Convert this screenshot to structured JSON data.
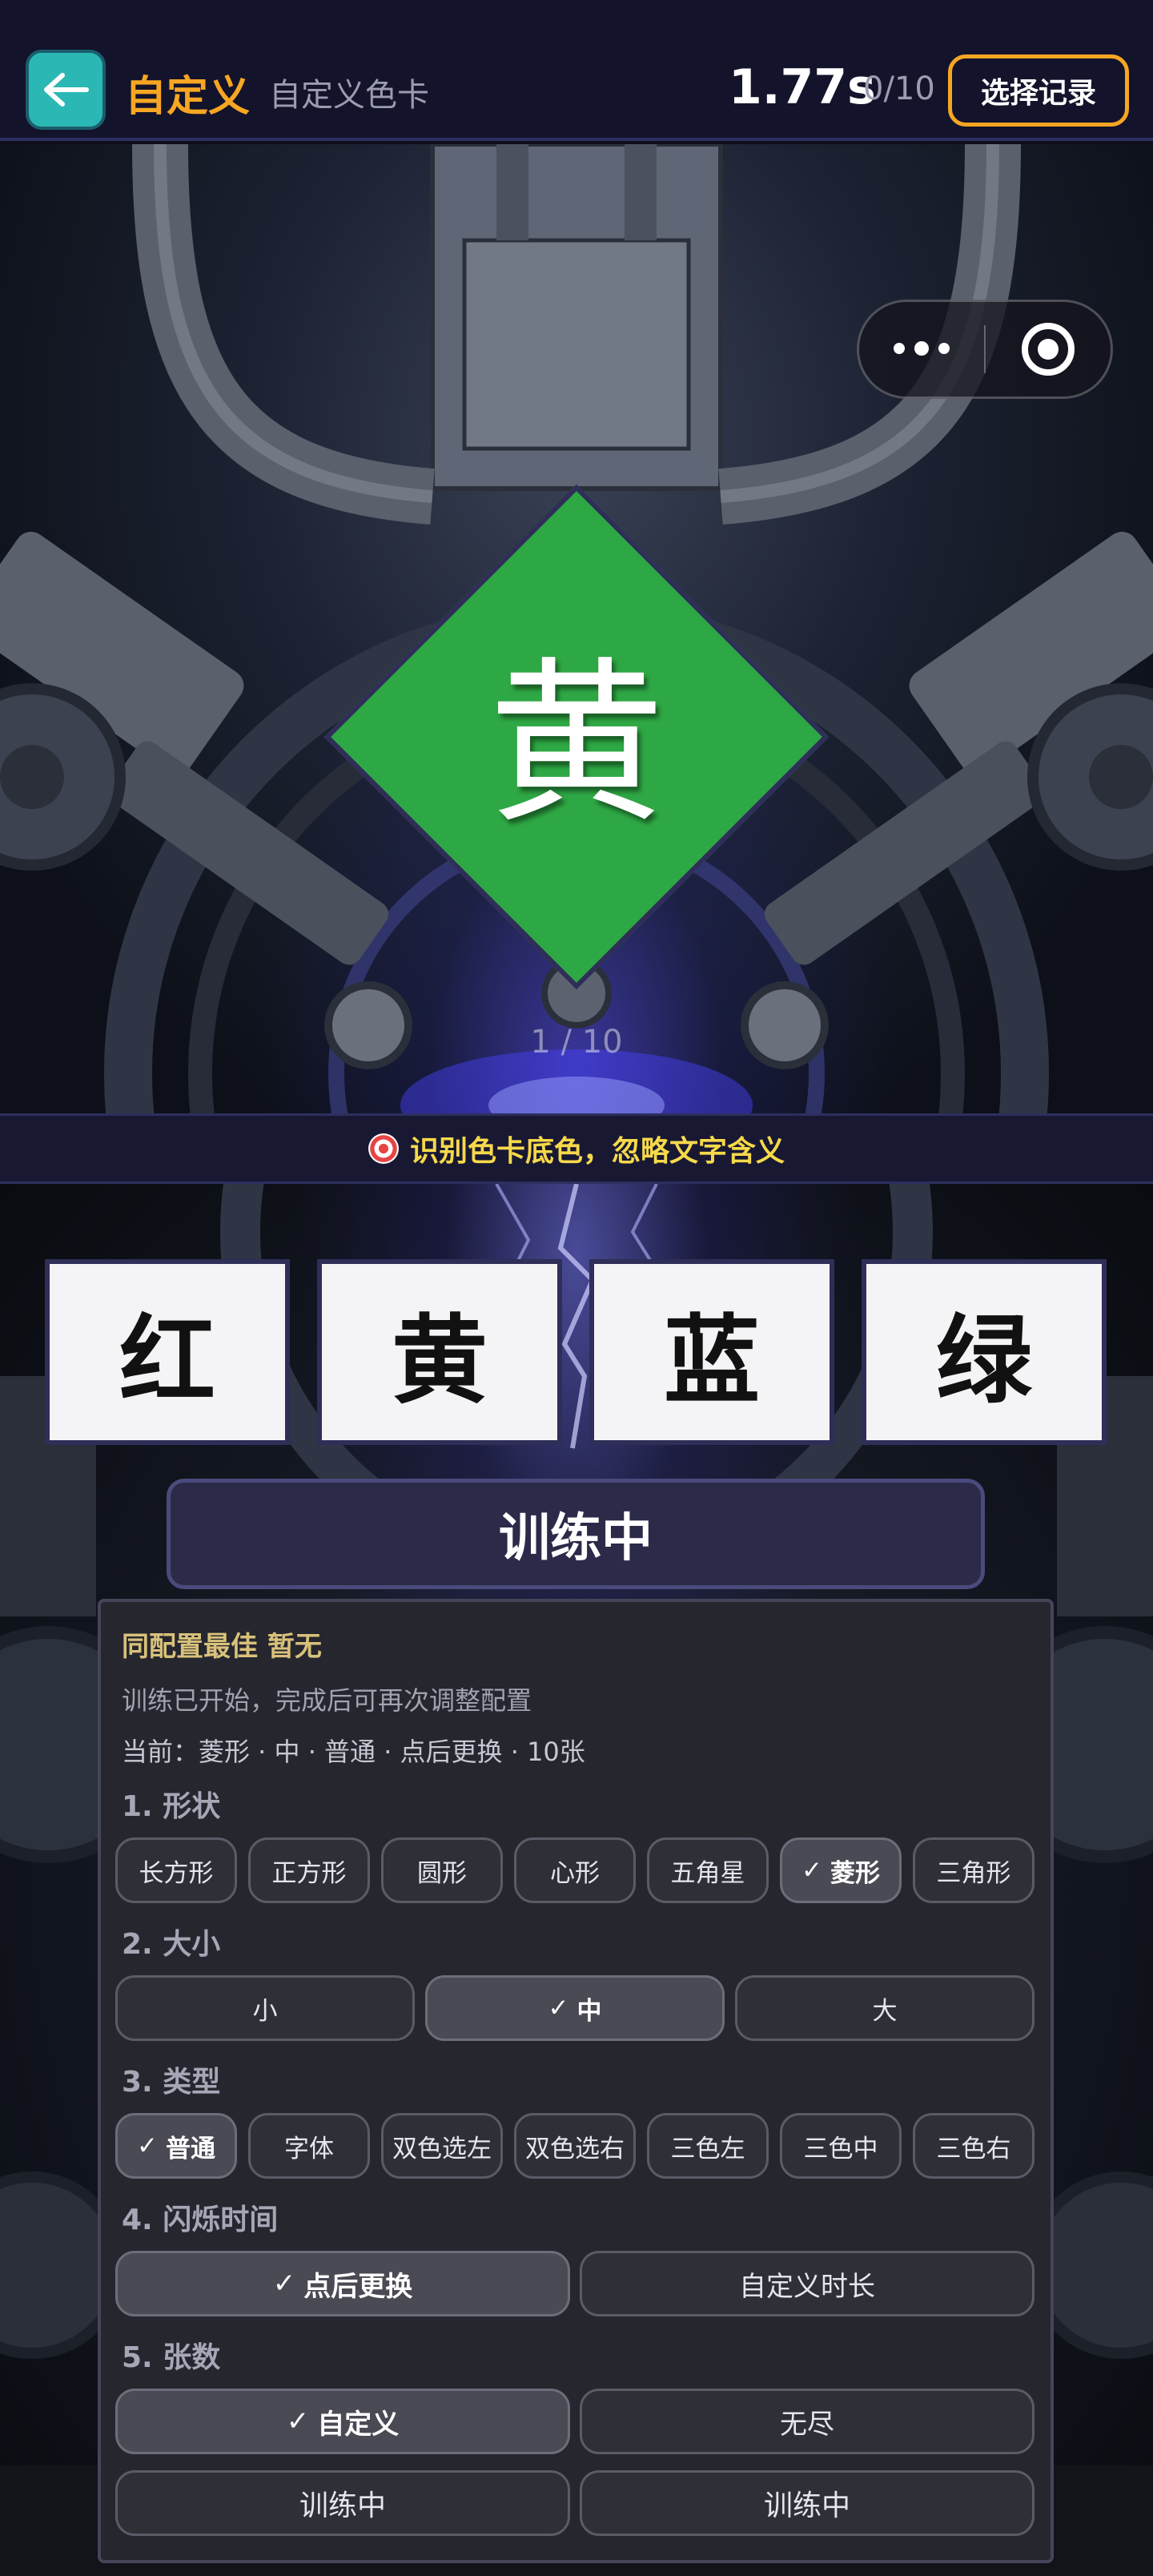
{
  "header": {
    "title": "自定义",
    "subtitle": "自定义色卡",
    "timer": "1.77s",
    "count": "0/10",
    "record_button": "选择记录"
  },
  "card": {
    "text": "黄",
    "shape": "菱形",
    "color": "#2ea844",
    "progress": "1 / 10"
  },
  "hint": "识别色卡底色，忽略文字含义",
  "answers": [
    "红",
    "黄",
    "蓝",
    "绿"
  ],
  "train_button": "训练中",
  "panel": {
    "best": "同配置最佳 暂无",
    "note": "训练已开始，完成后可再次调整配置",
    "current": "当前：菱形 · 中 · 普通 · 点后更换 · 10张",
    "sections": {
      "shape": {
        "title": "1. 形状",
        "options": [
          "长方形",
          "正方形",
          "圆形",
          "心形",
          "五角星",
          "菱形",
          "三角形"
        ],
        "selected": "菱形"
      },
      "size": {
        "title": "2. 大小",
        "options": [
          "小",
          "中",
          "大"
        ],
        "selected": "中"
      },
      "type": {
        "title": "3. 类型",
        "options": [
          "普通",
          "字体",
          "双色选左",
          "双色选右",
          "三色左",
          "三色中",
          "三色右"
        ],
        "selected": "普通"
      },
      "flash": {
        "title": "4. 闪烁时间",
        "options": [
          "点后更换",
          "自定义时长"
        ],
        "selected": "点后更换"
      },
      "cards": {
        "title": "5. 张数",
        "options": [
          "自定义",
          "无尽"
        ],
        "selected": "自定义"
      }
    },
    "bottom_buttons": [
      "训练中",
      "训练中"
    ]
  },
  "colors": {
    "accent": "#f6a623",
    "back_button": "#2bb8b4",
    "hint_text": "#f6d94a",
    "best_text": "#d8c17a"
  },
  "icons": {
    "back": "arrow-left-icon",
    "menu": "more-dots-icon",
    "close": "target-circle-icon",
    "hint": "target-emoji-icon",
    "check": "checkmark-icon"
  }
}
